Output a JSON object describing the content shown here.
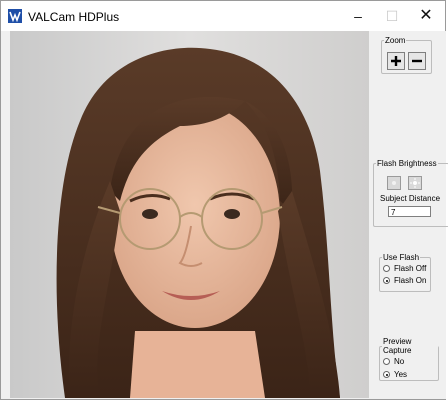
{
  "window": {
    "title": "VALCam HDPlus",
    "min_glyph": "–",
    "max_glyph": "☐",
    "close_glyph": "✕"
  },
  "zoom": {
    "legend": "Zoom"
  },
  "flash_brightness": {
    "legend": "Flash Brightness",
    "subject_distance_label": "Subject Distance",
    "subject_distance_value": "7"
  },
  "use_flash": {
    "legend": "Use Flash",
    "options": [
      "Flash Off",
      "Flash On"
    ],
    "selected": "Flash On"
  },
  "preview_capture": {
    "legend": "Preview Capture",
    "options": [
      "No",
      "Yes"
    ],
    "selected": "Yes"
  }
}
